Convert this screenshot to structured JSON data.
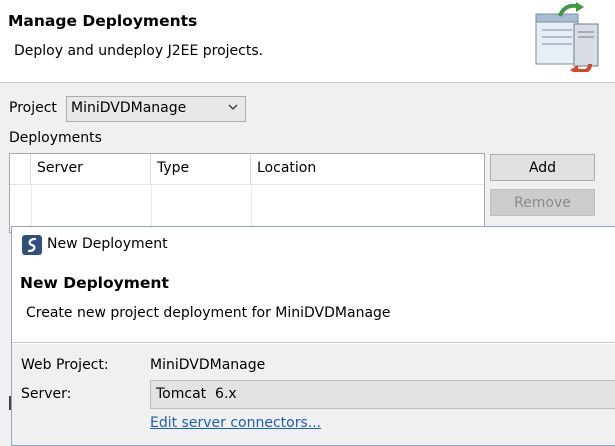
{
  "manage": {
    "title": "Manage Deployments",
    "description": "Deploy and undeploy J2EE projects.",
    "project_label": "Project",
    "project_value": "MiniDVDManage",
    "deployments_label": "Deployments",
    "columns": [
      "Server",
      "Type",
      "Location"
    ],
    "buttons": {
      "add": "Add",
      "remove": "Remove"
    },
    "remove_enabled": false
  },
  "new_deployment": {
    "window_title": "New Deployment",
    "header_title": "New Deployment",
    "header_description": "Create new project deployment for MiniDVDManage",
    "web_project_label": "Web Project:",
    "web_project_value": "MiniDVDManage",
    "server_label": "Server:",
    "server_value": "Tomcat  6.x",
    "edit_link": "Edit server connectors..."
  },
  "colors": {
    "link": "#1a5fc4",
    "dialog_border": "#8fa7c4",
    "panel_bg": "#f0f0f0"
  }
}
